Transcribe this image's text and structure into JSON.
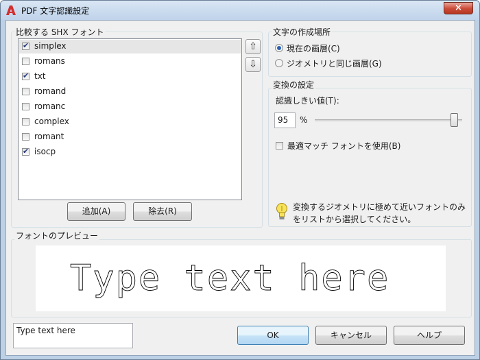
{
  "window": {
    "title": "PDF 文字認識設定",
    "close_glyph": "×"
  },
  "shx_group": {
    "label": "比較する SHX フォント",
    "fonts": [
      {
        "name": "simplex",
        "checked": true
      },
      {
        "name": "romans",
        "checked": false
      },
      {
        "name": "txt",
        "checked": true
      },
      {
        "name": "romand",
        "checked": false
      },
      {
        "name": "romanc",
        "checked": false
      },
      {
        "name": "complex",
        "checked": false
      },
      {
        "name": "romant",
        "checked": false
      },
      {
        "name": "isocp",
        "checked": true
      }
    ],
    "move_up_icon": "⇧",
    "move_down_icon": "⇩",
    "add_button": "追加(A)",
    "remove_button": "除去(R)"
  },
  "layer_group": {
    "label": "文字の作成場所",
    "options": [
      "現在の画層(C)",
      "ジオメトリと同じ画層(G)"
    ],
    "selected": 0
  },
  "conversion_group": {
    "label": "変換の設定",
    "threshold_label": "認識しきい値(T):",
    "threshold_value": "95",
    "percent": "%",
    "slider_level": 0.95,
    "best_match_label": "最適マッチ フォントを使用(B)",
    "best_match_checked": false,
    "hint_line1": "変換するジオメトリに極めて近いフォントのみ",
    "hint_line2": "をリストから選択してください。"
  },
  "preview_group": {
    "label": "フォントのプレビュー",
    "preview_text": "Type text here"
  },
  "sample_input": {
    "value": "Type text here"
  },
  "footer": {
    "ok": "OK",
    "cancel": "キャンセル",
    "help": "ヘルプ"
  },
  "colors": {
    "title_bar": "#c4d6ec",
    "close_button": "#c94a36",
    "accent": "#3c7fb1"
  }
}
